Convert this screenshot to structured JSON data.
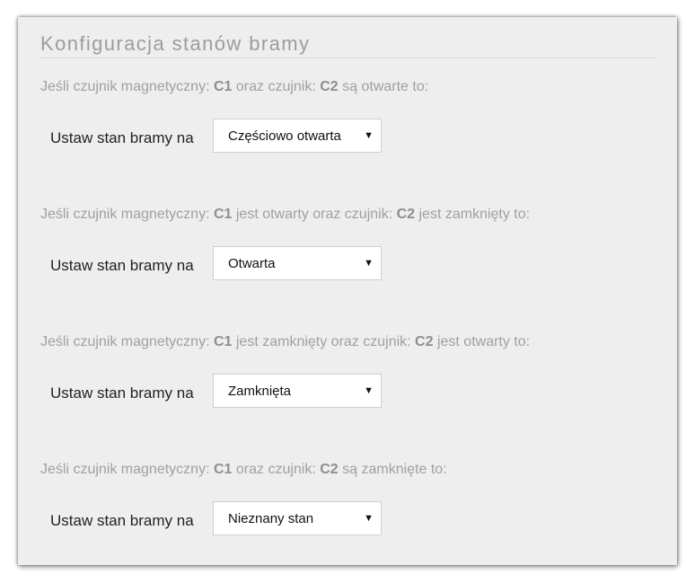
{
  "panel": {
    "title": "Konfiguracja stanów bramy"
  },
  "sections": [
    {
      "cond_prefix": "Jeśli czujnik magnetyczny: ",
      "sensor1": "C1",
      "cond_mid": " oraz czujnik: ",
      "sensor2": "C2",
      "cond_suffix": " są otwarte to:",
      "label": "Ustaw stan bramy na",
      "selected": "Częściowo otwarta"
    },
    {
      "cond_prefix": "Jeśli czujnik magnetyczny: ",
      "sensor1": "C1",
      "cond_mid": " jest otwarty oraz czujnik: ",
      "sensor2": "C2",
      "cond_suffix": " jest zamknięty to:",
      "label": "Ustaw stan bramy na",
      "selected": "Otwarta"
    },
    {
      "cond_prefix": "Jeśli czujnik magnetyczny: ",
      "sensor1": "C1",
      "cond_mid": " jest zamknięty oraz czujnik: ",
      "sensor2": "C2",
      "cond_suffix": " jest otwarty to:",
      "label": "Ustaw stan bramy na",
      "selected": "Zamknięta"
    },
    {
      "cond_prefix": "Jeśli czujnik magnetyczny: ",
      "sensor1": "C1",
      "cond_mid": " oraz czujnik: ",
      "sensor2": "C2",
      "cond_suffix": " są zamknięte to:",
      "label": "Ustaw stan bramy na",
      "selected": "Nieznany stan"
    }
  ],
  "icons": {
    "dropdown": "chevron-down-icon"
  }
}
